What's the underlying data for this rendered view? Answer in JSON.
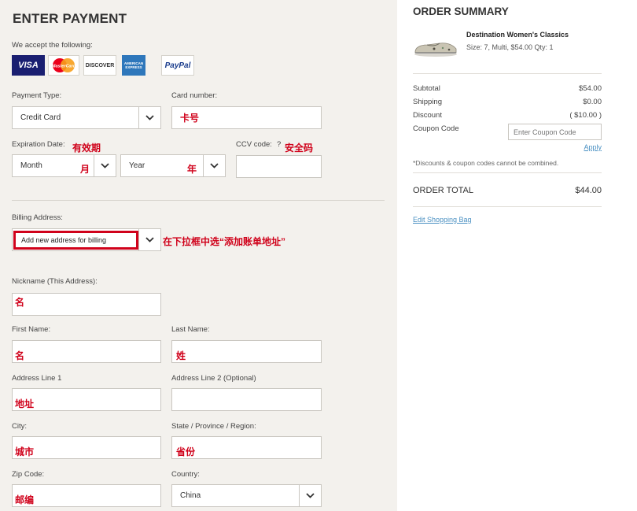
{
  "payment": {
    "title": "ENTER PAYMENT",
    "accept_label": "We accept the following:",
    "cards": [
      "VISA",
      "MasterCard",
      "DISCOVER",
      "AMERICAN EXPRESS",
      "PayPal"
    ],
    "payment_type_label": "Payment Type:",
    "payment_type_value": "Credit Card",
    "card_number_label": "Card number:",
    "card_number_note": "卡号",
    "expiration_label": "Expiration Date:",
    "expiration_note": "有效期",
    "month_value": "Month",
    "month_note": "月",
    "year_value": "Year",
    "year_note": "年",
    "ccv_label": "CCV code:",
    "ccv_help": "?",
    "ccv_note": "安全码"
  },
  "billing": {
    "label": "Billing Address:",
    "select_value": "Add new address for billing",
    "note": "在下拉框中选“添加账单地址”",
    "nickname_label": "Nickname (This Address):",
    "nickname_note": "名",
    "first_name_label": "First Name:",
    "first_name_note": "名",
    "last_name_label": "Last Name:",
    "last_name_note": "姓",
    "address1_label": "Address Line 1",
    "address1_note": "地址",
    "address2_label": "Address Line 2 (Optional)",
    "city_label": "City:",
    "city_note": "城市",
    "state_label": "State / Province / Region:",
    "state_note": "省份",
    "zip_label": "Zip Code:",
    "zip_note": "邮编",
    "country_label": "Country:",
    "country_value": "China"
  },
  "summary": {
    "title": "ORDER SUMMARY",
    "product_name": "Destination Women's Classics",
    "product_details": "Size: 7, Multi, $54.00 Qty: 1",
    "subtotal_label": "Subtotal",
    "subtotal_value": "$54.00",
    "shipping_label": "Shipping",
    "shipping_value": "$0.00",
    "discount_label": "Discount",
    "discount_value": "( $10.00 )",
    "coupon_label": "Coupon Code",
    "coupon_placeholder": "Enter Coupon Code",
    "apply_label": "Apply",
    "disclaimer": "*Discounts & coupon codes cannot be combined.",
    "total_label": "ORDER TOTAL",
    "total_value": "$44.00",
    "edit_bag_label": "Edit Shopping Bag"
  }
}
